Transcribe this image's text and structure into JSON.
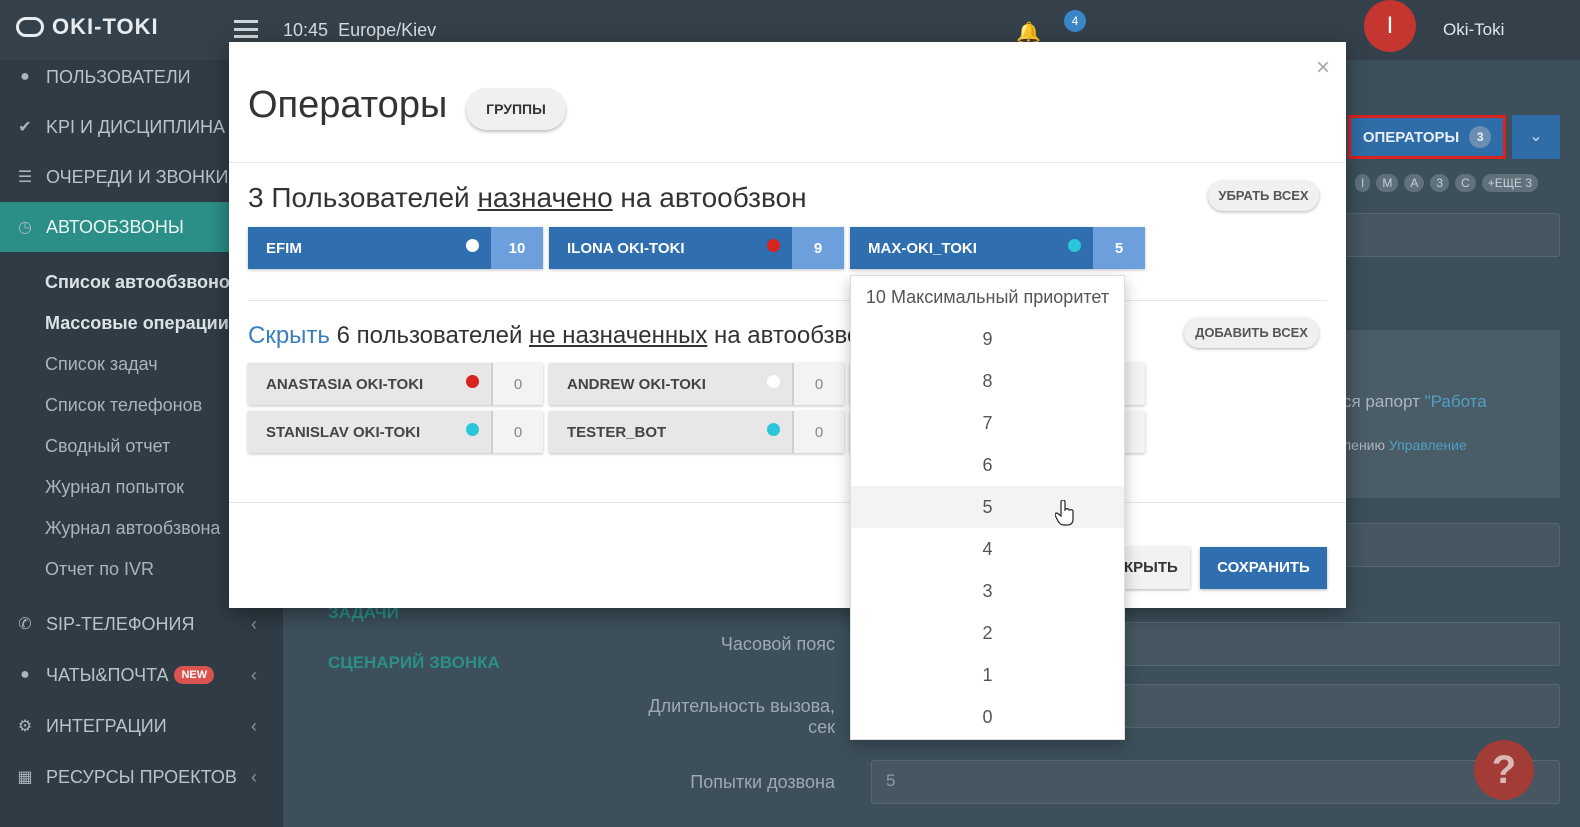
{
  "topbar": {
    "logo": "OKI-TOKI",
    "time": "10:45",
    "timezone": "Europe/Kiev",
    "notification_count": "4",
    "avatar_letter": "I",
    "user_name": "Oki-Toki"
  },
  "sidebar": {
    "items": [
      {
        "label": "ПОЛЬЗОВАТЕЛИ",
        "icon": "user-icon"
      },
      {
        "label": "KPI И ДИСЦИПЛИНА",
        "icon": "check-icon"
      },
      {
        "label": "ОЧЕРЕДИ И ЗВОНКИ",
        "icon": "list-icon"
      },
      {
        "label": "АВТООБЗВОНЫ",
        "icon": "clock-icon",
        "active": true
      },
      {
        "label": "SIP-ТЕЛЕФОНИЯ",
        "icon": "phone-icon"
      },
      {
        "label": "ЧАТЫ&ПОЧТА",
        "icon": "chat-icon",
        "badge": "NEW"
      },
      {
        "label": "ИНТЕГРАЦИИ",
        "icon": "gear-icon"
      },
      {
        "label": "РЕСУРСЫ ПРОЕКТОВ",
        "icon": "grid-icon"
      }
    ],
    "subitems": [
      {
        "label": "Список автообзвонов",
        "bold": true
      },
      {
        "label": "Массовые операции",
        "bold": true
      },
      {
        "label": "Список задач"
      },
      {
        "label": "Список телефонов"
      },
      {
        "label": "Сводный отчет"
      },
      {
        "label": "Журнал попыток"
      },
      {
        "label": "Журнал автообзвона"
      },
      {
        "label": "Отчет по IVR"
      }
    ]
  },
  "background": {
    "operators_button": "ОПЕРАТОРЫ",
    "operators_count": "3",
    "letter_pills": [
      "I",
      "M",
      "A",
      "3",
      "C",
      "+ЕЩЕ 3"
    ],
    "report_text": "ся рапорт ",
    "report_link": "\"Работа",
    "manage_text": "лению ",
    "manage_link": "Управление",
    "tasks_link": "ЗАДАЧИ",
    "scenario_link": "СЦЕНАРИЙ ЗВОНКА",
    "timezone_label": "Часовой пояс",
    "duration_label_1": "Длительность вызова,",
    "duration_label_2": "сек",
    "attempts_label": "Попытки дозвона",
    "attempts_value": "5"
  },
  "modal": {
    "title": "Операторы",
    "groups_button": "ГРУППЫ",
    "close_icon": "×",
    "assigned": {
      "count_text": "3 Пользователей ",
      "link_text": "назначено",
      "rest_text": " на автообзвон",
      "remove_all": "УБРАТЬ ВСЕХ",
      "operators": [
        {
          "name": "EFIM",
          "priority": "10",
          "status_color": "#ffffff"
        },
        {
          "name": "ILONA OKI-TOKI",
          "priority": "9",
          "status_color": "#d9231f"
        },
        {
          "name": "MAX-OKI_TOKI",
          "priority": "5",
          "status_color": "#2bc6d9"
        }
      ]
    },
    "unassigned": {
      "hide_link": "Скрыть",
      "count_text": " 6 пользователей ",
      "link_text": "не назначенных",
      "rest_text": " на автообзвон",
      "add_all": "ДОБАВИТЬ ВСЕХ",
      "operators": [
        {
          "name": "ANASTASIA OKI-TOKI",
          "priority": "0",
          "status_color": "#d9231f"
        },
        {
          "name": "ANDREW OKI-TOKI",
          "priority": "0",
          "status_color": "#ffffff"
        },
        {
          "name": "STANISLAV OKI-TOKI",
          "priority": "0",
          "status_color": "#2bc6d9"
        },
        {
          "name": "TESTER_BOT",
          "priority": "0",
          "status_color": "#2bc6d9"
        }
      ]
    },
    "close_button": "КРЫТЬ",
    "save_button": "СОХРАНИТЬ"
  },
  "priority_dropdown": {
    "options": [
      "10 Максимальный приоритет",
      "9",
      "8",
      "7",
      "6",
      "5",
      "4",
      "3",
      "2",
      "1",
      "0"
    ],
    "hovered": "5"
  }
}
